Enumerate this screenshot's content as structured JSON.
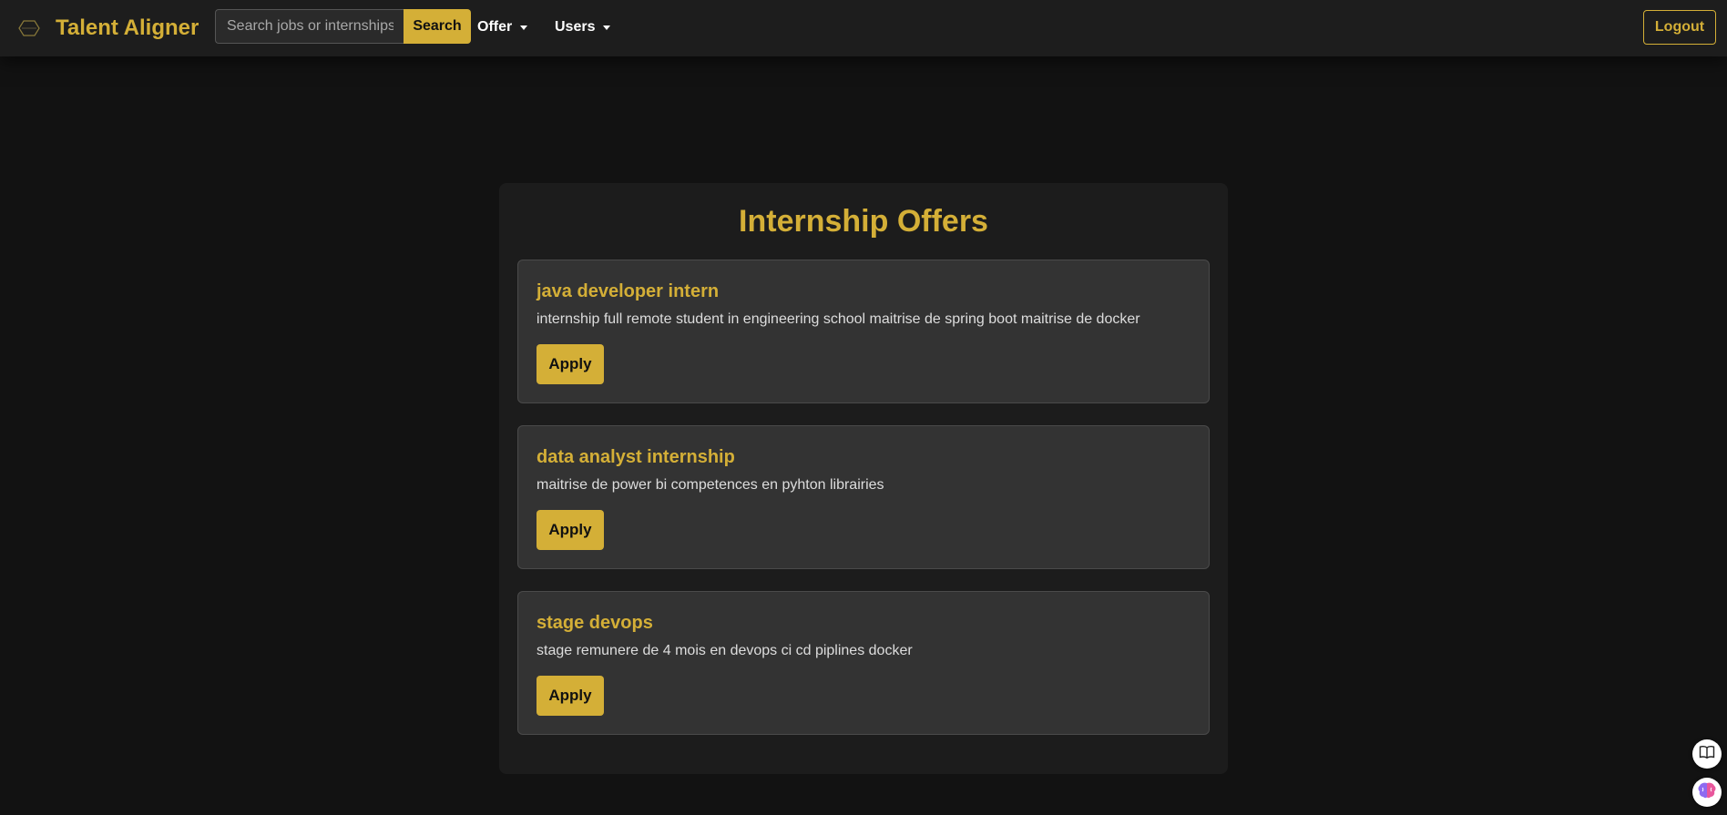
{
  "navbar": {
    "brand_name": "Talent Aligner",
    "logo_icon": "hexagon-logo-icon",
    "search_placeholder": "Search jobs or internships",
    "search_label": "Search",
    "menus": [
      {
        "label": "Offer"
      },
      {
        "label": "Users"
      }
    ],
    "logout_label": "Logout"
  },
  "main": {
    "title": "Internship Offers",
    "offers": [
      {
        "title": "java developer intern",
        "description": "internship full remote student in engineering school maitrise de spring boot maitrise de docker",
        "apply_label": "Apply"
      },
      {
        "title": "data analyst internship",
        "description": "maitrise de power bi competences en pyhton librairies",
        "apply_label": "Apply"
      },
      {
        "title": "stage devops",
        "description": "stage remunere de 4 mois en devops ci cd piplines docker",
        "apply_label": "Apply"
      }
    ]
  },
  "floating": {
    "reader_icon": "book-icon",
    "assistant_icon": "brain-icon"
  },
  "colors": {
    "accent": "#d4af37",
    "background": "#121212",
    "navbar": "#1d1d1d",
    "panel": "#1c1c1c",
    "card": "#333333"
  }
}
